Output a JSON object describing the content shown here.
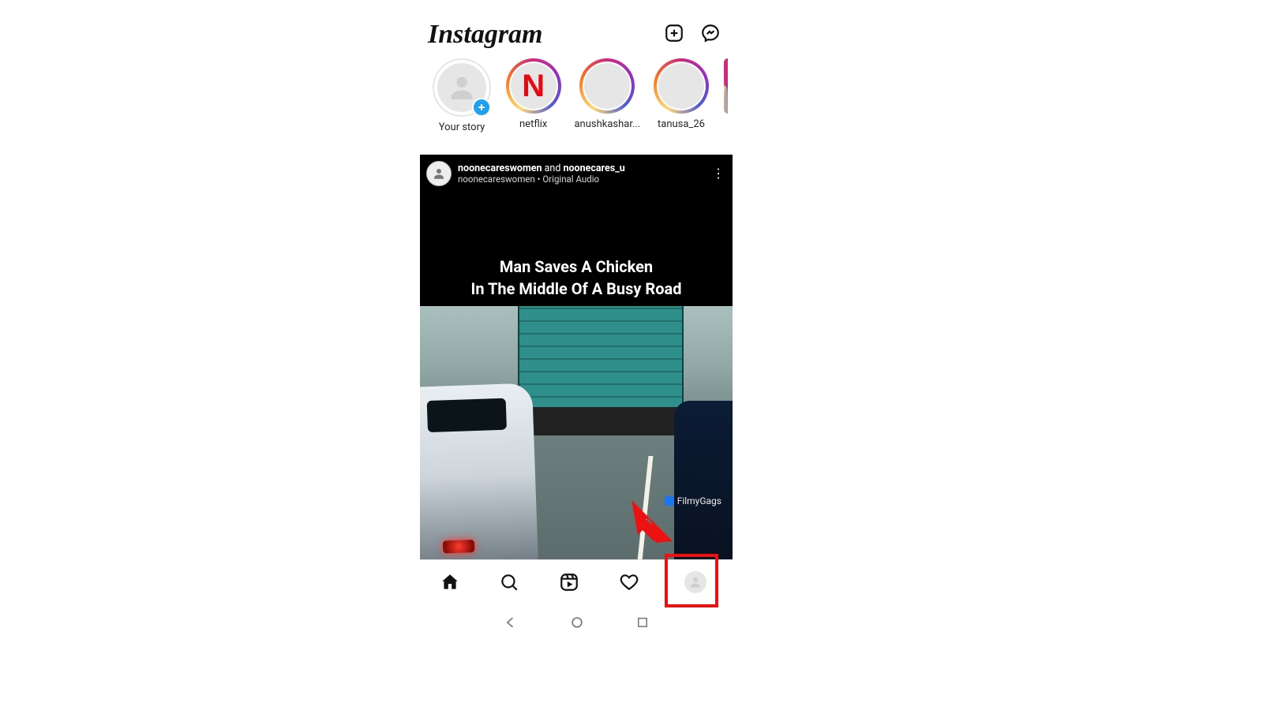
{
  "app": {
    "name": "Instagram"
  },
  "header": {
    "icons": {
      "create": "create-post-icon",
      "messenger": "messenger-icon"
    }
  },
  "stories": {
    "items": [
      {
        "label": "Your story",
        "type": "self"
      },
      {
        "label": "netflix",
        "type": "brand",
        "brand_letter": "N"
      },
      {
        "label": "anushkashar...",
        "type": "user"
      },
      {
        "label": "tanusa_26",
        "type": "user"
      }
    ]
  },
  "post": {
    "author_primary": "noonecareswomen",
    "author_connector": " and ",
    "author_secondary": "noonecares_u",
    "sub_author": "noonecareswomen",
    "sub_sep": " • ",
    "sub_audio": "Original Audio",
    "caption_line1": "Man Saves A Chicken",
    "caption_line2": "In The Middle Of A Busy Road",
    "watermark_text": "FilmyGags",
    "more_label": "⋮"
  },
  "nav": {
    "items": [
      "home",
      "search",
      "reels",
      "activity",
      "profile"
    ]
  },
  "annotation": {
    "target": "profile-tab",
    "style": "red-arrow-and-box"
  },
  "colors": {
    "brand_gradient": [
      "#feda75",
      "#fa7e1e",
      "#d62976",
      "#962fbf",
      "#4f5bd5"
    ],
    "annotation_red": "#e11",
    "plus_badge": "#1fa1f1"
  }
}
